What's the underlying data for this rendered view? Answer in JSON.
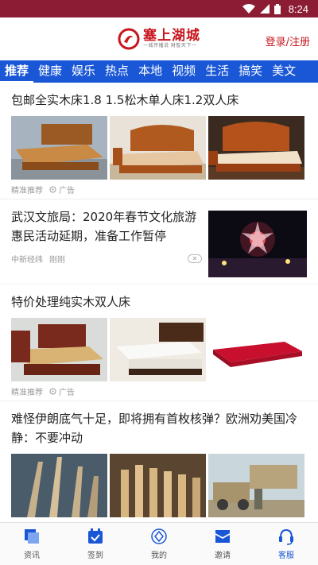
{
  "status_bar": {
    "time": "8:24"
  },
  "header": {
    "logo_title": "塞上湖城",
    "logo_slogan": "一城传播说 财智天下一",
    "login_label": "登录/注册"
  },
  "tabs": [
    {
      "label": "推荐",
      "active": true
    },
    {
      "label": "健康"
    },
    {
      "label": "娱乐"
    },
    {
      "label": "热点"
    },
    {
      "label": "本地"
    },
    {
      "label": "视频"
    },
    {
      "label": "生活"
    },
    {
      "label": "搞笑"
    },
    {
      "label": "美文"
    }
  ],
  "feed": {
    "item1": {
      "title": "包邮全实木床1.8 1.5松木单人床1.2双人床",
      "source": "精准推荐",
      "ad_label": "广告"
    },
    "item2": {
      "title": "武汉文旅局：2020年春节文化旅游惠民活动延期，准备工作暂停",
      "source": "中新经纬",
      "time": "刚刚"
    },
    "item3": {
      "title": "特价处理纯实木双人床",
      "source": "精准推荐",
      "ad_label": "广告"
    },
    "item4": {
      "title": "难怪伊朗底气十足，即将拥有首枚核弹？欧洲劝美国冷静：不要冲动"
    }
  },
  "bottom_nav": [
    {
      "label": "资讯",
      "icon": "news-icon",
      "active": false
    },
    {
      "label": "签到",
      "icon": "calendar-check-icon",
      "active": false
    },
    {
      "label": "我的",
      "icon": "profile-icon",
      "active": false
    },
    {
      "label": "邀请",
      "icon": "invite-icon",
      "active": false
    },
    {
      "label": "客服",
      "icon": "headset-icon",
      "active": true
    }
  ],
  "colors": {
    "status_bar": "#8c1c33",
    "brand_red": "#c7161e",
    "tab_bar": "#1a57d6"
  }
}
